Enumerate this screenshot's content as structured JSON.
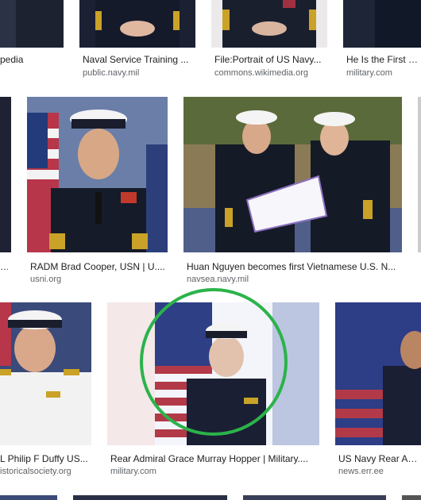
{
  "results": [
    {
      "title": "pedia",
      "source": ""
    },
    {
      "title": "Naval Service Training ...",
      "source": "public.navy.mil"
    },
    {
      "title": "File:Portrait of US Navy...",
      "source": "commons.wikimedia.org"
    },
    {
      "title": "He Is the First Vie",
      "source": "military.com"
    },
    {
      "title": "RADM Brad Cooper, USN | U....",
      "source": "usni.org"
    },
    {
      "title": "Huan Nguyen becomes first Vietnamese U.S. N...",
      "source": "navsea.navy.mil"
    },
    {
      "title": "L Philip F Duffy US...",
      "source": "istoricalsociety.org"
    },
    {
      "title": "Rear Admiral Grace Murray Hopper | Military....",
      "source": "military.com"
    },
    {
      "title": "US Navy Rear Adm",
      "source": "news.err.ee"
    }
  ],
  "highlight_color": "#2bb34a"
}
